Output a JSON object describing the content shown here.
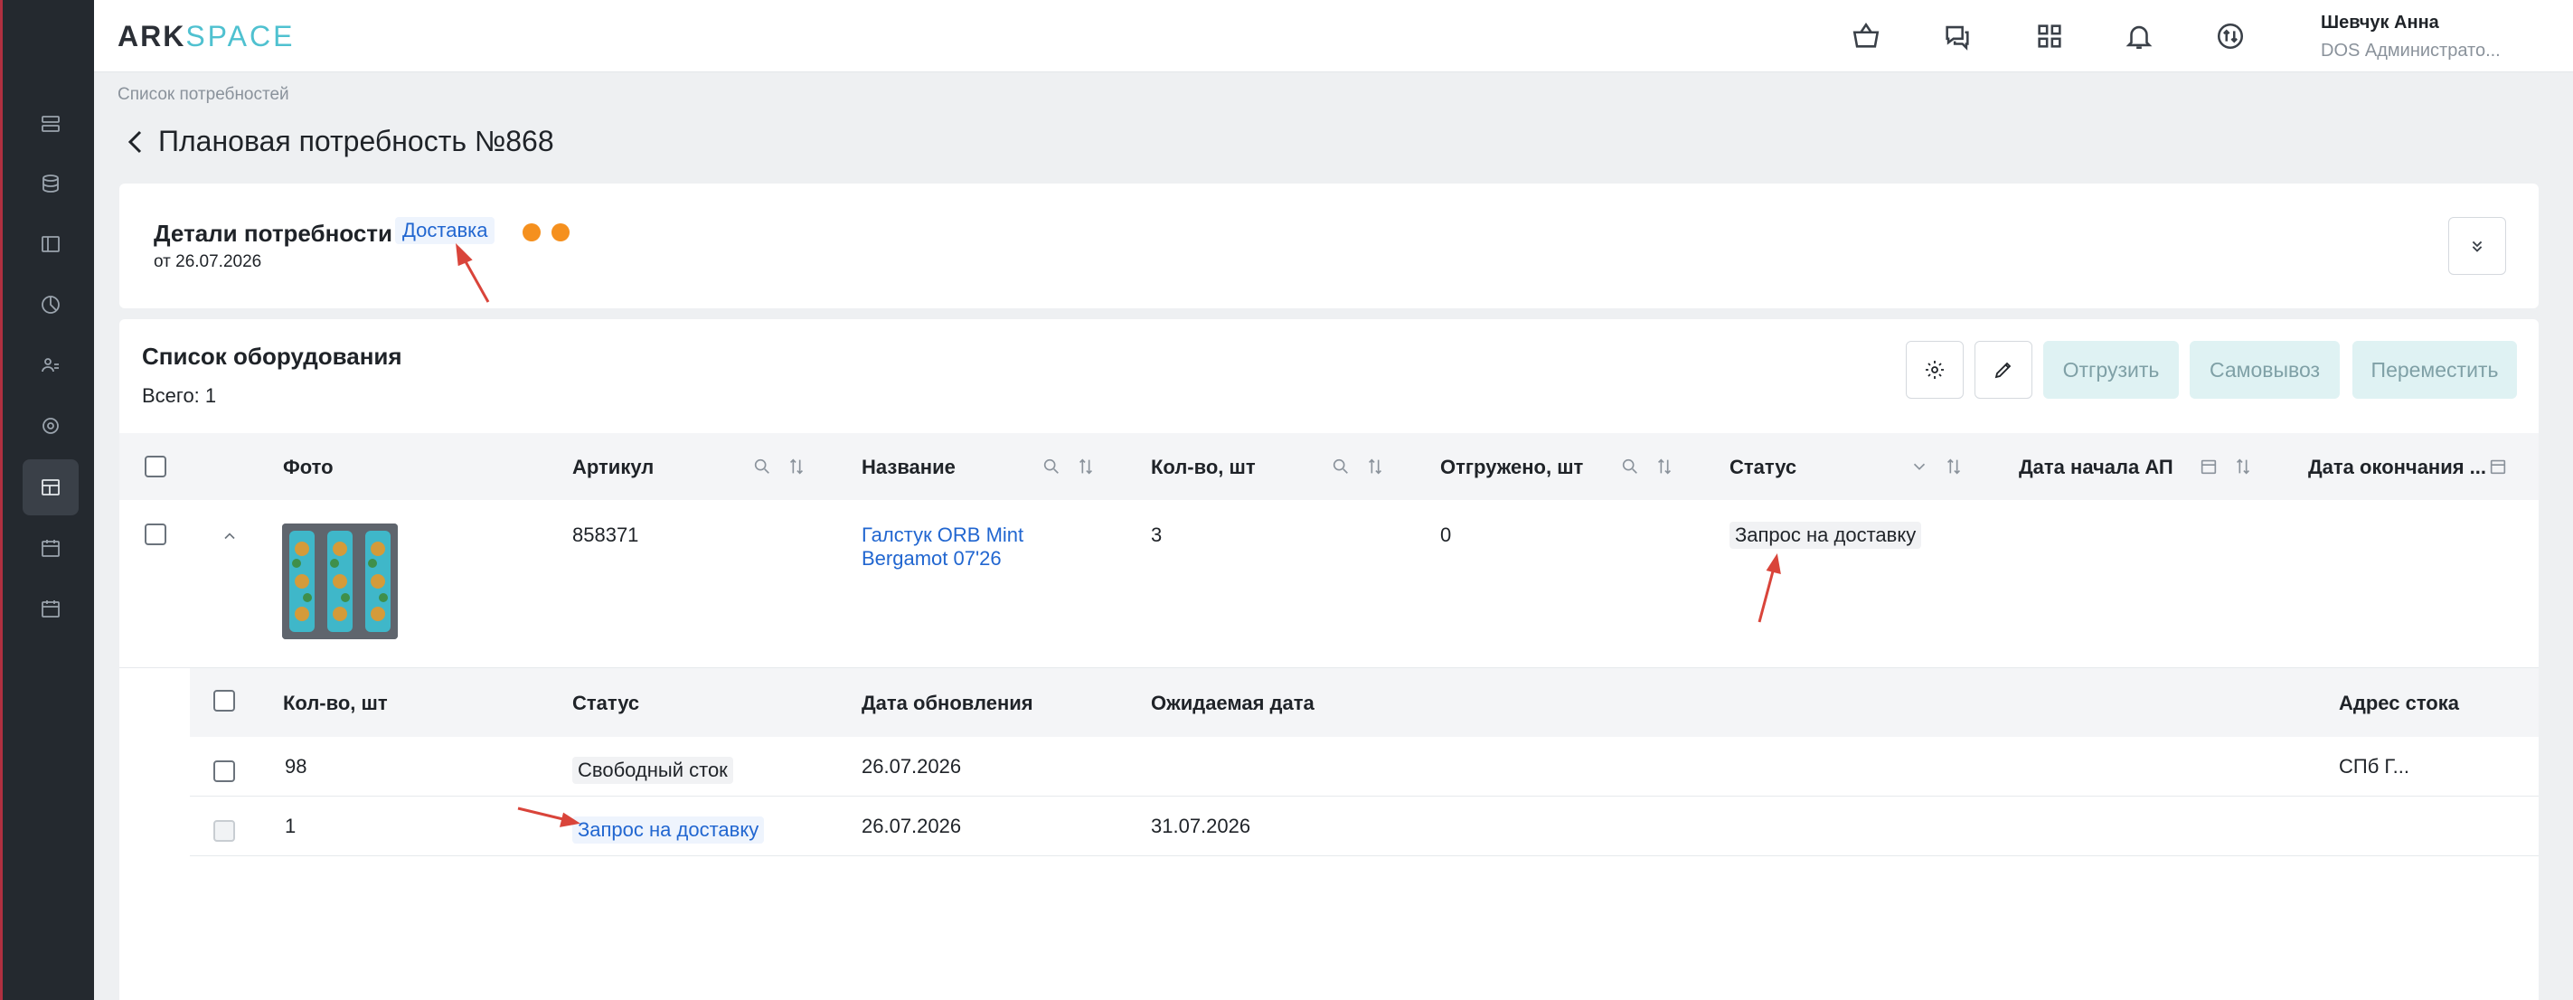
{
  "app": {
    "logo_part1": "ARK",
    "logo_part2": "SPACE"
  },
  "user": {
    "name": "Шевчук Анна",
    "role": "DOS Администрато..."
  },
  "breadcrumb": "Список потребностей",
  "page_title": "Плановая потребность №868",
  "details": {
    "title": "Детали потребности",
    "date": "от 26.07.2026",
    "badge": "Доставка",
    "dot_color": "#f5901e"
  },
  "equipment": {
    "title": "Список оборудования",
    "total": "Всего: 1",
    "buttons": {
      "ship": "Отгрузить",
      "pickup": "Самовывоз",
      "move": "Переместить"
    }
  },
  "table": {
    "columns": [
      "Фото",
      "Артикул",
      "Название",
      "Кол-во, шт",
      "Отгружено, шт",
      "Статус",
      "Дата начала АП",
      "Дата окончания ..."
    ],
    "row": {
      "article": "858371",
      "name_line1": "Галстук ORB Mint",
      "name_line2": "Bergamot 07'26",
      "qty": "3",
      "shipped": "0",
      "status": "Запрос на доставку"
    }
  },
  "subtable": {
    "columns": [
      "Кол-во, шт",
      "Статус",
      "Дата обновления",
      "Ожидаемая дата",
      "Адрес стока"
    ],
    "rows": [
      {
        "qty": "98",
        "status": "Свободный сток",
        "updated": "26.07.2026",
        "expected": "",
        "address": "СПб Г..."
      },
      {
        "qty": "1",
        "status": "Запрос на доставку",
        "updated": "26.07.2026",
        "expected": "31.07.2026",
        "address": ""
      }
    ]
  },
  "annotation_color": "#d9443a"
}
